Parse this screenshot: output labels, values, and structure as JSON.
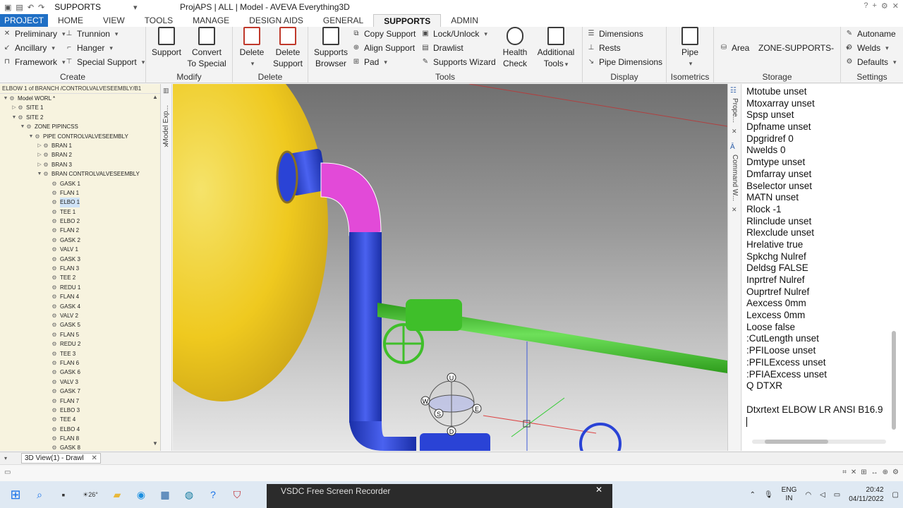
{
  "titlebar": {
    "qat_label": "SUPPORTS",
    "title": "ProjAPS | ALL | Model - AVEVA Everything3D"
  },
  "tabs": [
    {
      "label": "PROJECT"
    },
    {
      "label": "HOME"
    },
    {
      "label": "VIEW"
    },
    {
      "label": "TOOLS"
    },
    {
      "label": "MANAGE"
    },
    {
      "label": "DESIGN AIDS"
    },
    {
      "label": "GENERAL"
    },
    {
      "label": "SUPPORTS"
    },
    {
      "label": "ADMIN"
    }
  ],
  "ribbon": {
    "create": {
      "label": "Create",
      "preliminary": "Preliminary",
      "trunnion": "Trunnion",
      "ancillary": "Ancillary",
      "hanger": "Hanger",
      "framework": "Framework",
      "special_support": "Special Support"
    },
    "modify": {
      "label": "Modify",
      "support": "Support",
      "convert": "Convert",
      "convert2": "To Special"
    },
    "delete": {
      "label": "Delete",
      "delete": "Delete",
      "delete_support": "Delete",
      "delete_support2": "Support"
    },
    "tools": {
      "label": "Tools",
      "supports_browser": "Supports",
      "supports_browser2": "Browser",
      "copy_support": "Copy Support",
      "align_support": "Align Support",
      "pad": "Pad",
      "lock_unlock": "Lock/Unlock",
      "drawlist": "Drawlist",
      "supports_wizard": "Supports Wizard",
      "health_check": "Health",
      "health_check2": "Check",
      "additional_tools": "Additional",
      "additional_tools2": "Tools"
    },
    "display": {
      "label": "Display",
      "dimensions": "Dimensions",
      "rests": "Rests",
      "pipe_dimensions": "Pipe Dimensions"
    },
    "isometrics": {
      "label": "Isometrics",
      "pipe": "Pipe"
    },
    "storage": {
      "label": "Storage",
      "area": "Area",
      "zone": "ZONE-SUPPORTS-"
    },
    "settings": {
      "label": "Settings",
      "autoname": "Autoname",
      "welds": "Welds",
      "defaults": "Defaults"
    }
  },
  "tree": {
    "path": "ELBOW 1 of BRANCH /CONTROLVALVESEEMBLY/B1",
    "rows": [
      {
        "label": "Model WORL *",
        "indent": 0,
        "twisty": "▼"
      },
      {
        "label": "SITE 1",
        "indent": 1,
        "twisty": "▷"
      },
      {
        "label": "SITE 2",
        "indent": 1,
        "twisty": "▼"
      },
      {
        "label": "ZONE PIPINCSS",
        "indent": 2,
        "twisty": "▼"
      },
      {
        "label": "PIPE CONTROLVALVESEEMBLY",
        "indent": 3,
        "twisty": "▼"
      },
      {
        "label": "BRAN 1",
        "indent": 4,
        "twisty": "▷"
      },
      {
        "label": "BRAN 2",
        "indent": 4,
        "twisty": "▷"
      },
      {
        "label": "BRAN 3",
        "indent": 4,
        "twisty": "▷"
      },
      {
        "label": "BRAN CONTROLVALVESEEMBLY",
        "indent": 4,
        "twisty": "▼"
      },
      {
        "label": "GASK 1",
        "indent": 5,
        "twisty": ""
      },
      {
        "label": "FLAN 1",
        "indent": 5,
        "twisty": ""
      },
      {
        "label": "ELBO 1",
        "indent": 5,
        "twisty": "",
        "selected": true
      },
      {
        "label": "TEE 1",
        "indent": 5,
        "twisty": ""
      },
      {
        "label": "ELBO 2",
        "indent": 5,
        "twisty": ""
      },
      {
        "label": "FLAN 2",
        "indent": 5,
        "twisty": ""
      },
      {
        "label": "GASK 2",
        "indent": 5,
        "twisty": ""
      },
      {
        "label": "VALV 1",
        "indent": 5,
        "twisty": ""
      },
      {
        "label": "GASK 3",
        "indent": 5,
        "twisty": ""
      },
      {
        "label": "FLAN 3",
        "indent": 5,
        "twisty": ""
      },
      {
        "label": "TEE 2",
        "indent": 5,
        "twisty": ""
      },
      {
        "label": "REDU 1",
        "indent": 5,
        "twisty": ""
      },
      {
        "label": "FLAN 4",
        "indent": 5,
        "twisty": ""
      },
      {
        "label": "GASK 4",
        "indent": 5,
        "twisty": ""
      },
      {
        "label": "VALV 2",
        "indent": 5,
        "twisty": ""
      },
      {
        "label": "GASK 5",
        "indent": 5,
        "twisty": ""
      },
      {
        "label": "FLAN 5",
        "indent": 5,
        "twisty": ""
      },
      {
        "label": "REDU 2",
        "indent": 5,
        "twisty": ""
      },
      {
        "label": "TEE 3",
        "indent": 5,
        "twisty": ""
      },
      {
        "label": "FLAN 6",
        "indent": 5,
        "twisty": ""
      },
      {
        "label": "GASK 6",
        "indent": 5,
        "twisty": ""
      },
      {
        "label": "VALV 3",
        "indent": 5,
        "twisty": ""
      },
      {
        "label": "GASK 7",
        "indent": 5,
        "twisty": ""
      },
      {
        "label": "FLAN 7",
        "indent": 5,
        "twisty": ""
      },
      {
        "label": "ELBO 3",
        "indent": 5,
        "twisty": ""
      },
      {
        "label": "TEE 4",
        "indent": 5,
        "twisty": ""
      },
      {
        "label": "ELBO 4",
        "indent": 5,
        "twisty": ""
      },
      {
        "label": "FLAN 8",
        "indent": 5,
        "twisty": ""
      },
      {
        "label": "GASK 8",
        "indent": 5,
        "twisty": ""
      }
    ]
  },
  "side_tabs": {
    "model_explorer": "Model Exp...",
    "properties": "Prope...",
    "command_window": "Command W..."
  },
  "command_output": [
    "Mtotube unset",
    "Mtoxarray unset",
    "Spsp unset",
    "Dpfname unset",
    "Dpgridref 0",
    "Nwelds 0",
    "Dmtype unset",
    "Dmfarray unset",
    "Bselector unset",
    "MATN unset",
    "Rlock -1",
    "Rlinclude unset",
    "Rlexclude unset",
    "Hrelative true",
    "Spkchg Nulref",
    "Deldsg FALSE",
    "Inprtref Nulref",
    "Ouprtref Nulref",
    "Aexcess 0mm",
    "Lexcess 0mm",
    "Loose false",
    ":CutLength unset",
    ":PFILoose unset",
    ":PFILExcess unset",
    ":PFIAExcess unset",
    "Q DTXR",
    "",
    "Dtxrtext ELBOW LR ANSI B16.9"
  ],
  "view_tab": {
    "label": "3D View(1) - Drawl"
  },
  "gizmo": {
    "u": "U",
    "w": "W",
    "s": "S",
    "e": "E",
    "d": "D"
  },
  "taskbar": {
    "recorder_title": "VSDC Free Screen Recorder",
    "weather": "26°",
    "lang1": "ENG",
    "lang2": "IN",
    "time": "20:42",
    "date": "04/11/2022"
  },
  "colors": {
    "accent": "#1f6fc5",
    "vessel": "#f2d02a",
    "pipe_blue": "#2a43d6",
    "elbow_magenta": "#e24ad8",
    "pipe_green": "#3fbf2a"
  }
}
